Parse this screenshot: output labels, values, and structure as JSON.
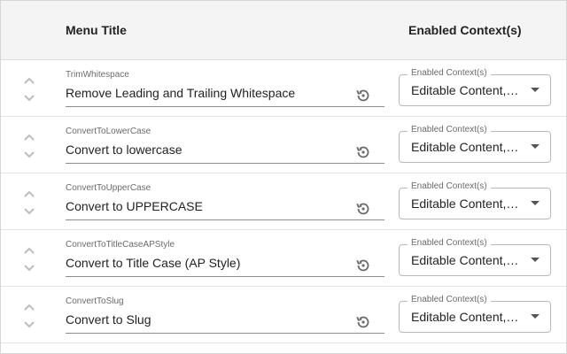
{
  "header": {
    "menu_title": "Menu Title",
    "enabled_contexts": "Enabled Context(s)"
  },
  "rows": [
    {
      "id": "TrimWhitespace",
      "title": "Remove Leading and Trailing Whitespace",
      "context_label": "Enabled Context(s)",
      "context_value": "Editable Content, Selection"
    },
    {
      "id": "ConvertToLowerCase",
      "title": "Convert to lowercase",
      "context_label": "Enabled Context(s)",
      "context_value": "Editable Content, Selection"
    },
    {
      "id": "ConvertToUpperCase",
      "title": "Convert to UPPERCASE",
      "context_label": "Enabled Context(s)",
      "context_value": "Editable Content, Selection"
    },
    {
      "id": "ConvertToTitleCaseAPStyle",
      "title": "Convert to Title Case (AP Style)",
      "context_label": "Enabled Context(s)",
      "context_value": "Editable Content, Selection"
    },
    {
      "id": "ConvertToSlug",
      "title": "Convert to Slug",
      "context_label": "Enabled Context(s)",
      "context_value": "Editable Content, Selection"
    }
  ],
  "icons": {
    "reorder": "drag-handle-icon",
    "reset": "reset-icon",
    "dropdown": "dropdown-arrow-icon"
  }
}
